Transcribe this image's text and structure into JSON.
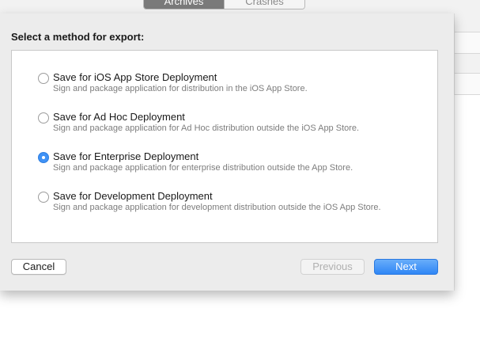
{
  "toolbar": {
    "segments": [
      {
        "label": "Archives",
        "active": true
      },
      {
        "label": "Crashes",
        "active": false
      }
    ]
  },
  "sheet": {
    "title": "Select a method for export:",
    "options": [
      {
        "title": "Save for iOS App Store Deployment",
        "description": "Sign and package application for distribution in the iOS App Store.",
        "selected": false
      },
      {
        "title": "Save for Ad Hoc Deployment",
        "description": "Sign and package application for Ad Hoc distribution outside the iOS App Store.",
        "selected": false
      },
      {
        "title": "Save for Enterprise Deployment",
        "description": "Sign and package application for enterprise distribution outside the App Store.",
        "selected": true
      },
      {
        "title": "Save for Development Deployment",
        "description": "Sign and package application for development distribution outside the iOS App Store.",
        "selected": false
      }
    ],
    "buttons": {
      "cancel": "Cancel",
      "previous": "Previous",
      "next": "Next"
    }
  },
  "colors": {
    "accent": "#3f92f6",
    "sheet_background": "#ececec"
  }
}
